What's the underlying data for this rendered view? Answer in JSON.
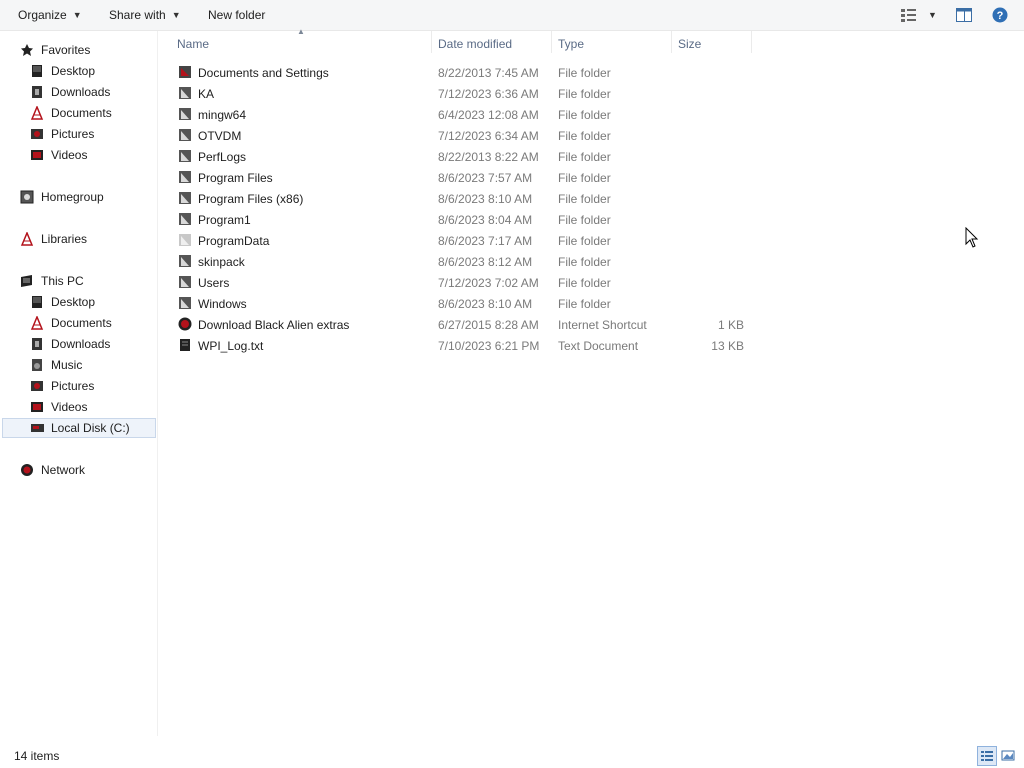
{
  "toolbar": {
    "organize": "Organize",
    "share_with": "Share with",
    "new_folder": "New folder"
  },
  "columns": {
    "name": "Name",
    "date": "Date modified",
    "type": "Type",
    "size": "Size"
  },
  "nav": {
    "favorites": "Favorites",
    "fav_desktop": "Desktop",
    "fav_downloads": "Downloads",
    "fav_documents": "Documents",
    "fav_pictures": "Pictures",
    "fav_videos": "Videos",
    "homegroup": "Homegroup",
    "libraries": "Libraries",
    "this_pc": "This PC",
    "pc_desktop": "Desktop",
    "pc_documents": "Documents",
    "pc_downloads": "Downloads",
    "pc_music": "Music",
    "pc_pictures": "Pictures",
    "pc_videos": "Videos",
    "pc_local_disk": "Local Disk (C:)",
    "network": "Network"
  },
  "files": [
    {
      "name": "Documents and Settings",
      "date": "8/22/2013 7:45 AM",
      "type": "File folder",
      "size": "",
      "icon": "folder-shortcut-icon"
    },
    {
      "name": "KA",
      "date": "7/12/2023 6:36 AM",
      "type": "File folder",
      "size": "",
      "icon": "folder-icon"
    },
    {
      "name": "mingw64",
      "date": "6/4/2023 12:08 AM",
      "type": "File folder",
      "size": "",
      "icon": "folder-icon"
    },
    {
      "name": "OTVDM",
      "date": "7/12/2023 6:34 AM",
      "type": "File folder",
      "size": "",
      "icon": "folder-icon"
    },
    {
      "name": "PerfLogs",
      "date": "8/22/2013 8:22 AM",
      "type": "File folder",
      "size": "",
      "icon": "folder-icon"
    },
    {
      "name": "Program Files",
      "date": "8/6/2023 7:57 AM",
      "type": "File folder",
      "size": "",
      "icon": "folder-icon"
    },
    {
      "name": "Program Files (x86)",
      "date": "8/6/2023 8:10 AM",
      "type": "File folder",
      "size": "",
      "icon": "folder-icon"
    },
    {
      "name": "Program1",
      "date": "8/6/2023 8:04 AM",
      "type": "File folder",
      "size": "",
      "icon": "folder-icon"
    },
    {
      "name": "ProgramData",
      "date": "8/6/2023 7:17 AM",
      "type": "File folder",
      "size": "",
      "icon": "folder-hidden-icon"
    },
    {
      "name": "skinpack",
      "date": "8/6/2023 8:12 AM",
      "type": "File folder",
      "size": "",
      "icon": "folder-icon"
    },
    {
      "name": "Users",
      "date": "7/12/2023 7:02 AM",
      "type": "File folder",
      "size": "",
      "icon": "folder-icon"
    },
    {
      "name": "Windows",
      "date": "8/6/2023 8:10 AM",
      "type": "File folder",
      "size": "",
      "icon": "folder-icon"
    },
    {
      "name": "Download Black Alien extras",
      "date": "6/27/2015 8:28 AM",
      "type": "Internet Shortcut",
      "size": "1 KB",
      "icon": "internet-shortcut-icon"
    },
    {
      "name": "WPI_Log.txt",
      "date": "7/10/2023 6:21 PM",
      "type": "Text Document",
      "size": "13 KB",
      "icon": "text-document-icon"
    }
  ],
  "status": {
    "item_count": "14 items"
  },
  "icons": {
    "toolbar_view": "view-options-icon",
    "preview_pane": "preview-pane-icon",
    "help": "help-icon",
    "details_view": "details-view-icon",
    "large_icons_view": "large-icons-view-icon"
  },
  "colors": {
    "accent_red": "#b3121b",
    "header_text": "#5a6b86",
    "help_blue": "#2f6fb5"
  }
}
